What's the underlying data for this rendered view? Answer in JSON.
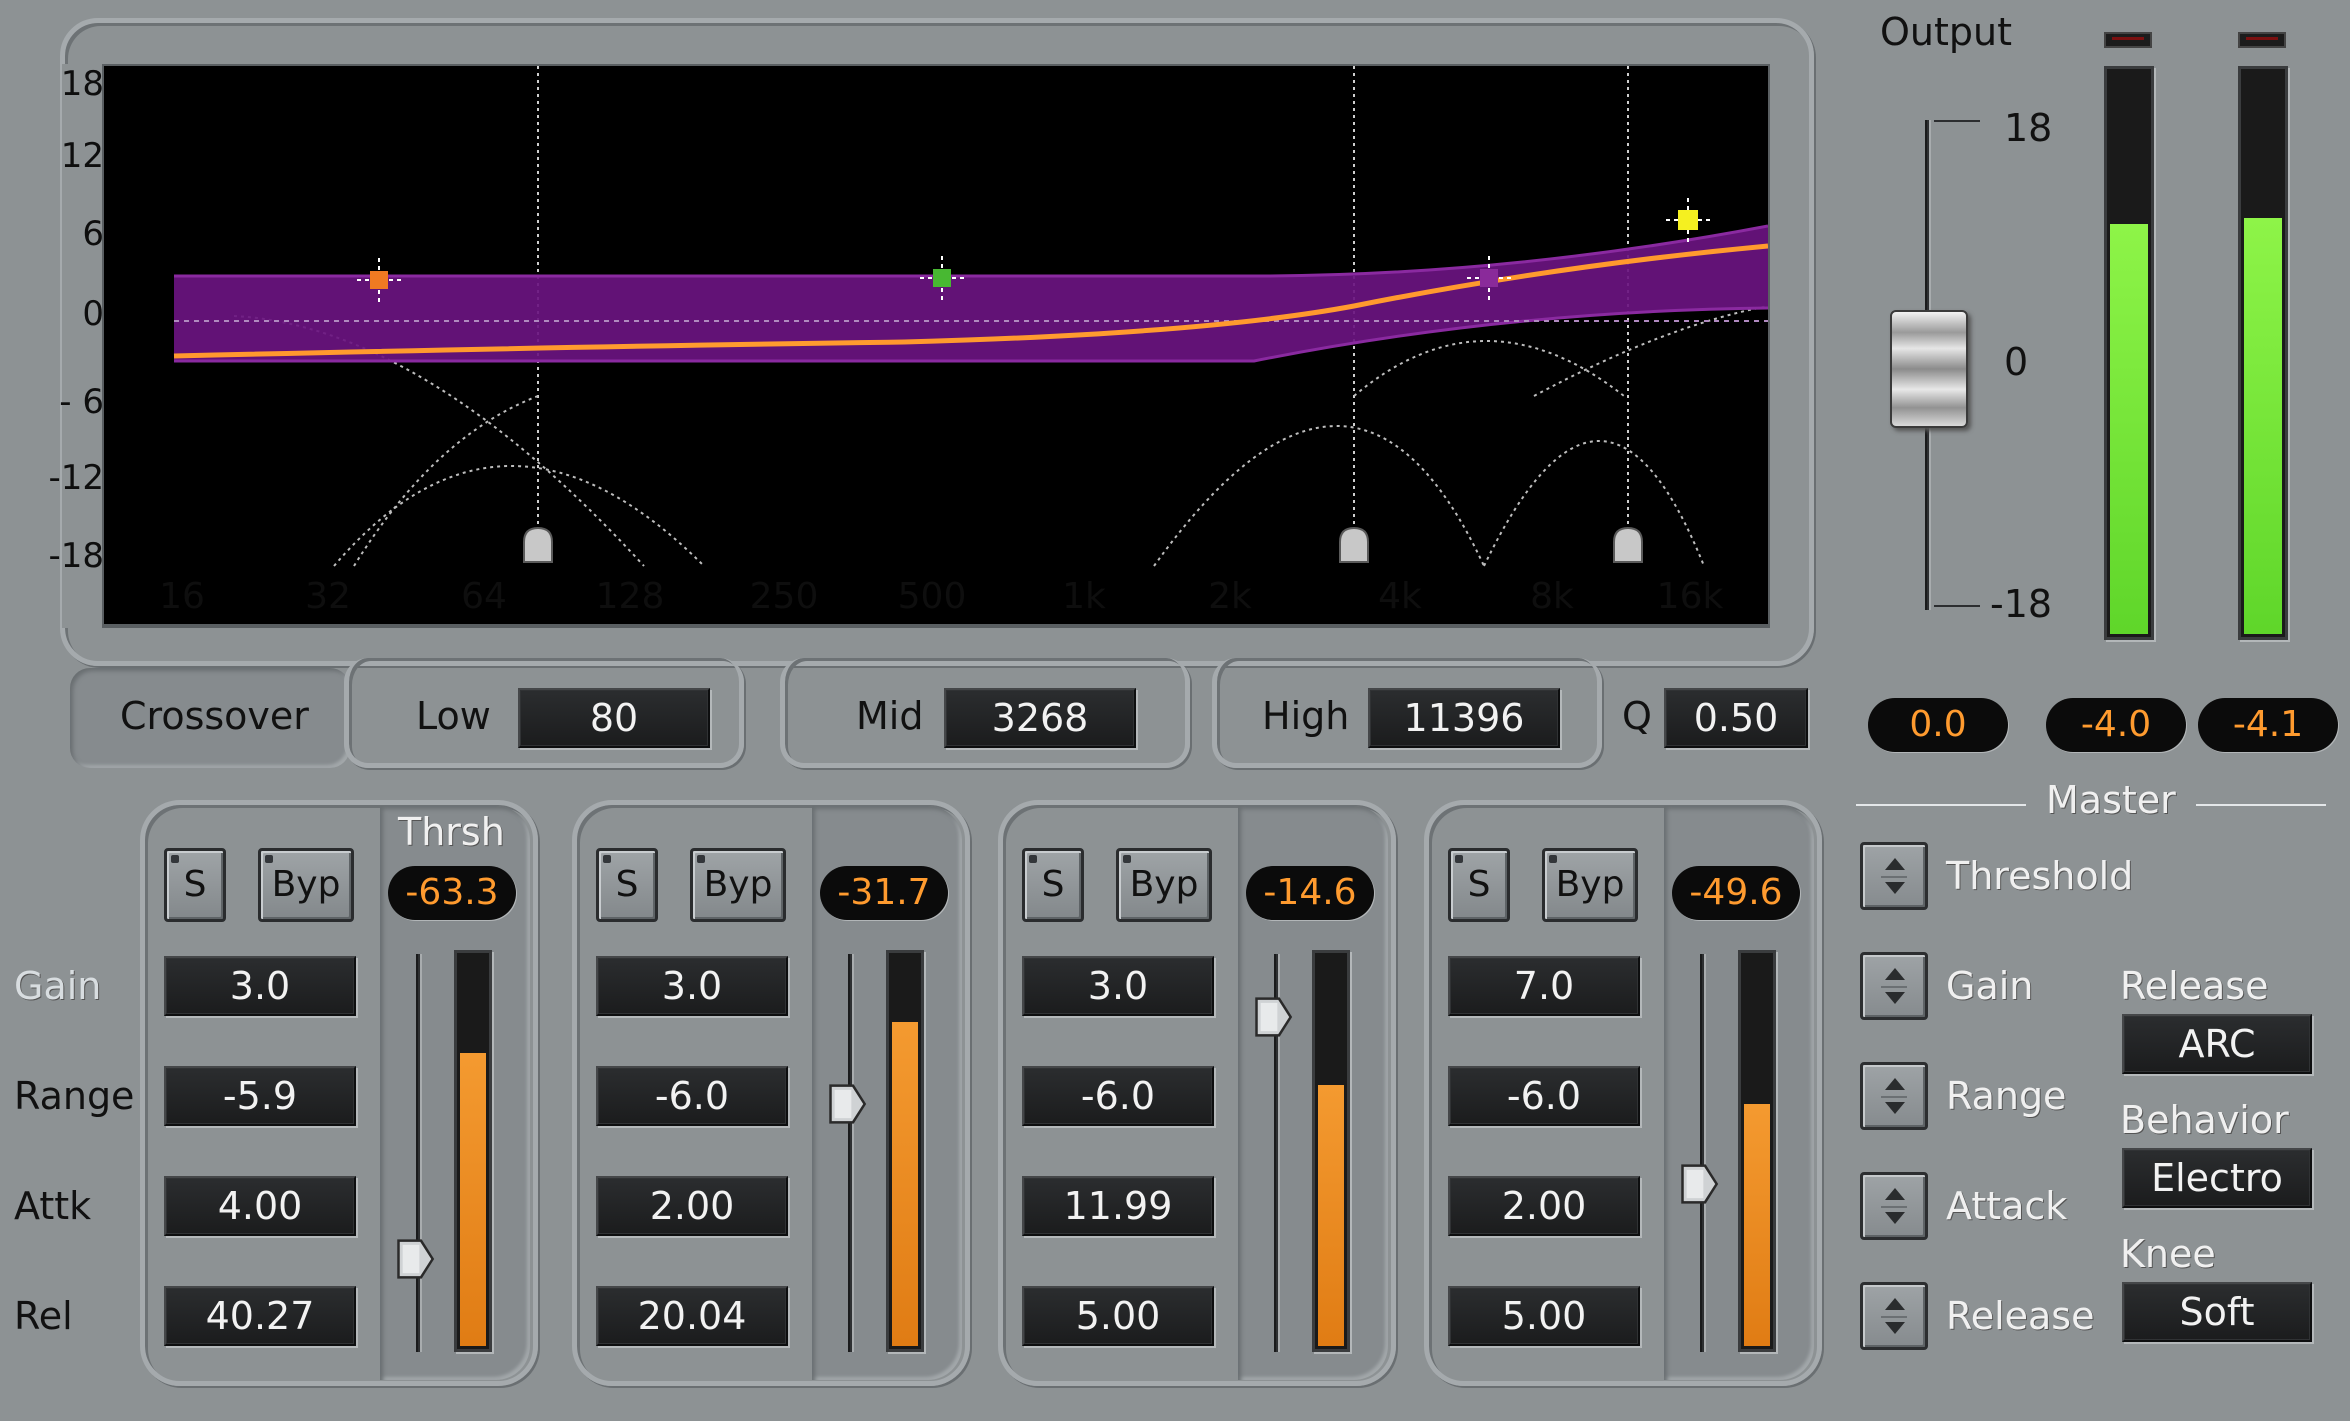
{
  "graph": {
    "y_ticks": [
      "18",
      "12",
      "6",
      "0",
      "- 6",
      "-12",
      "-18"
    ],
    "x_ticks": [
      "16",
      "32",
      "64",
      "128",
      "250",
      "500",
      "1k",
      "2k",
      "4k",
      "8k",
      "16k"
    ]
  },
  "output": {
    "title": "Output",
    "scale_top": "18",
    "scale_mid": "0",
    "scale_bottom": "-18",
    "fader_value": "0.0",
    "meter_left_value": "-4.0",
    "meter_right_value": "-4.1",
    "meter_left_level": 0.73,
    "meter_right_level": 0.74
  },
  "crossover": {
    "label": "Crossover",
    "low_label": "Low",
    "low_value": "80",
    "mid_label": "Mid",
    "mid_value": "3268",
    "high_label": "High",
    "high_value": "11396",
    "q_label": "Q",
    "q_value": "0.50"
  },
  "row_labels": {
    "gain": "Gain",
    "range": "Range",
    "attack": "Attk",
    "release": "Rel",
    "threshold": "Thrsh"
  },
  "bands": [
    {
      "solo": "S",
      "bypass": "Byp",
      "threshold": "-63.3",
      "gain": "3.0",
      "range": "-5.9",
      "attack": "4.00",
      "release": "40.27",
      "threshold_level": 0.23,
      "meter_level": 0.75
    },
    {
      "solo": "S",
      "bypass": "Byp",
      "threshold": "-31.7",
      "gain": "3.0",
      "range": "-6.0",
      "attack": "2.00",
      "release": "20.04",
      "threshold_level": 0.62,
      "meter_level": 0.83
    },
    {
      "solo": "S",
      "bypass": "Byp",
      "threshold": "-14.6",
      "gain": "3.0",
      "range": "-6.0",
      "attack": "11.99",
      "release": "5.00",
      "threshold_level": 0.84,
      "meter_level": 0.67
    },
    {
      "solo": "S",
      "bypass": "Byp",
      "threshold": "-49.6",
      "gain": "7.0",
      "range": "-6.0",
      "attack": "2.00",
      "release": "5.00",
      "threshold_level": 0.42,
      "meter_level": 0.62
    }
  ],
  "master": {
    "title": "Master",
    "threshold": "Threshold",
    "gain": "Gain",
    "range": "Range",
    "attack": "Attack",
    "release": "Release",
    "release_label": "Release",
    "release_value": "ARC",
    "behavior_label": "Behavior",
    "behavior_value": "Electro",
    "knee_label": "Knee",
    "knee_value": "Soft"
  },
  "colors": {
    "curve": "#ff9a2e",
    "band_fill": "#6a1380",
    "meter_green": "#79ee3c",
    "meter_orange": "#f08b1f",
    "node_low": "#f07a22",
    "node_mid": "#48b832",
    "node_high": "#8a2a9a",
    "node_top": "#f5f020"
  }
}
